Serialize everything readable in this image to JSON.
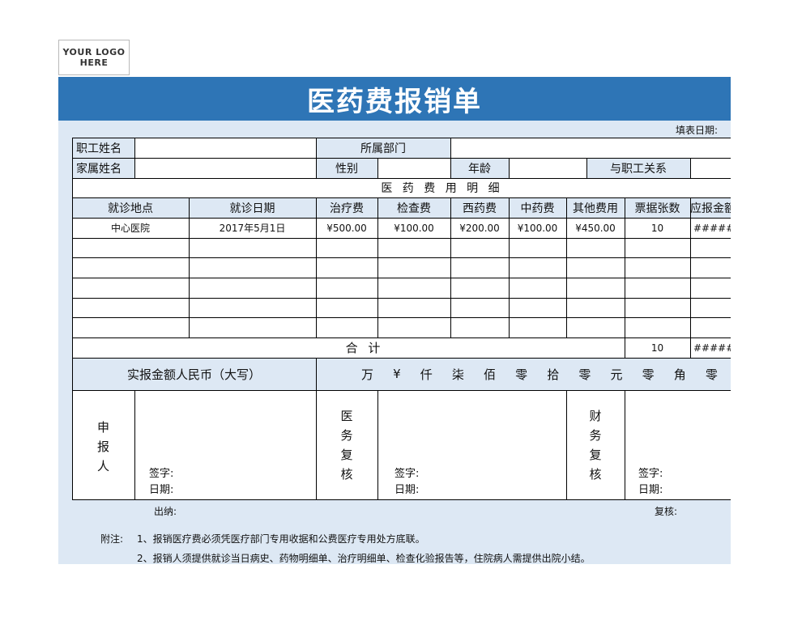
{
  "logo": {
    "line1": "YOUR LOGO",
    "line2": "HERE"
  },
  "title": "医药费报销单",
  "fill_date_label": "填表日期:",
  "info": {
    "employee_name_label": "职工姓名",
    "employee_name_value": "",
    "department_label": "所属部门",
    "department_value": "",
    "family_name_label": "家属姓名",
    "family_name_value": "",
    "gender_label": "性别",
    "gender_value": "",
    "age_label": "年龄",
    "age_value": "",
    "relation_label": "与职工关系",
    "relation_value": ""
  },
  "detail_title": "医 药 费 用 明 细",
  "columns": [
    "就诊地点",
    "就诊日期",
    "治疗费",
    "检查费",
    "西药费",
    "中药费",
    "其他费用",
    "票据张数",
    "应报金额"
  ],
  "rows": [
    [
      "中心医院",
      "2017年5月1日",
      "¥500.00",
      "¥100.00",
      "¥200.00",
      "¥100.00",
      "¥450.00",
      "10",
      "#####"
    ],
    [
      "",
      "",
      "",
      "",
      "",
      "",
      "",
      "",
      ""
    ],
    [
      "",
      "",
      "",
      "",
      "",
      "",
      "",
      "",
      ""
    ],
    [
      "",
      "",
      "",
      "",
      "",
      "",
      "",
      "",
      ""
    ],
    [
      "",
      "",
      "",
      "",
      "",
      "",
      "",
      "",
      ""
    ],
    [
      "",
      "",
      "",
      "",
      "",
      "",
      "",
      "",
      ""
    ]
  ],
  "total": {
    "label": "合 计",
    "receipts": "10",
    "amount": "#####"
  },
  "amount_words": {
    "label": "实报金额人民币（大写）",
    "chars": [
      "万",
      "¥",
      "仟",
      "柒",
      "佰",
      "零",
      "拾",
      "零",
      "元",
      "零",
      "角",
      "零"
    ]
  },
  "sign": {
    "applicant": [
      "申",
      "报",
      "人"
    ],
    "medical": [
      "医",
      "务",
      "复",
      "核"
    ],
    "finance": [
      "财",
      "务",
      "复",
      "核"
    ],
    "signature_label": "签字:",
    "date_label": "日期:"
  },
  "footer": {
    "cashier_label": "出纳:",
    "reviewer_label": "复核:",
    "note_label": "附注:",
    "notes": [
      "1、报销医疗费必须凭医疗部门专用收据和公费医疗专用处方底联。",
      "2、报销人须提供就诊当日病史、药物明细单、治疗明细单、检查化验报告等，住院病人需提供出院小结。"
    ]
  }
}
